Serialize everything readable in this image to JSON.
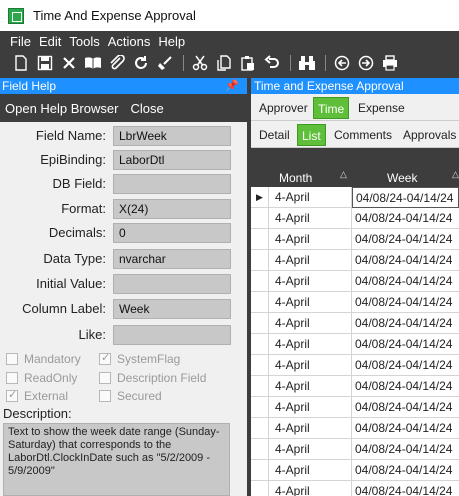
{
  "window": {
    "title": "Time And Expense Approval"
  },
  "menu": [
    "File",
    "Edit",
    "Tools",
    "Actions",
    "Help"
  ],
  "toolbar": {
    "icons": [
      "new-icon",
      "save-icon",
      "delete-icon",
      "open-book-icon",
      "attach-icon",
      "refresh-icon",
      "clear-icon",
      "cut-icon",
      "copy-icon",
      "paste-icon",
      "undo-icon",
      "binoculars-icon",
      "back-icon",
      "forward-icon",
      "print-icon"
    ]
  },
  "field_help": {
    "title": "Field Help",
    "open_help_browser": "Open Help Browser",
    "close": "Close",
    "fields": [
      {
        "label": "Field Name:",
        "value": "LbrWeek"
      },
      {
        "label": "EpiBinding:",
        "value": "LaborDtl"
      },
      {
        "label": "DB Field:",
        "value": ""
      },
      {
        "label": "Format:",
        "value": "X(24)"
      },
      {
        "label": "Decimals:",
        "value": "0"
      },
      {
        "label": "Data Type:",
        "value": "nvarchar"
      },
      {
        "label": "Initial Value:",
        "value": ""
      },
      {
        "label": "Column Label:",
        "value": "Week"
      },
      {
        "label": "Like:",
        "value": ""
      }
    ],
    "checkboxes": [
      {
        "label": "Mandatory",
        "checked": false
      },
      {
        "label": "SystemFlag",
        "checked": true
      },
      {
        "label": "ReadOnly",
        "checked": false
      },
      {
        "label": "Description Field",
        "checked": false
      },
      {
        "label": "External",
        "checked": true
      },
      {
        "label": "Secured",
        "checked": false
      }
    ],
    "description_label": "Description:",
    "description_text": "Text to show the week date range (Sunday-Saturday) that corresponds to the LaborDtl.ClockInDate such as \"5/2/2009 - 5/9/2009\""
  },
  "approval": {
    "title": "Time and Expense Approval",
    "tabs": [
      "Approver",
      "Time",
      "Expense"
    ],
    "active_tab": "Time",
    "subtabs": [
      "Detail",
      "List",
      "Comments",
      "Approvals"
    ],
    "active_subtab": "List",
    "columns": [
      "Month",
      "Week"
    ],
    "rows": [
      {
        "month": "4-April",
        "week": "04/08/24-04/14/24"
      },
      {
        "month": "4-April",
        "week": "04/08/24-04/14/24"
      },
      {
        "month": "4-April",
        "week": "04/08/24-04/14/24"
      },
      {
        "month": "4-April",
        "week": "04/08/24-04/14/24"
      },
      {
        "month": "4-April",
        "week": "04/08/24-04/14/24"
      },
      {
        "month": "4-April",
        "week": "04/08/24-04/14/24"
      },
      {
        "month": "4-April",
        "week": "04/08/24-04/14/24"
      },
      {
        "month": "4-April",
        "week": "04/08/24-04/14/24"
      },
      {
        "month": "4-April",
        "week": "04/08/24-04/14/24"
      },
      {
        "month": "4-April",
        "week": "04/08/24-04/14/24"
      },
      {
        "month": "4-April",
        "week": "04/08/24-04/14/24"
      },
      {
        "month": "4-April",
        "week": "04/08/24-04/14/24"
      },
      {
        "month": "4-April",
        "week": "04/08/24-04/14/24"
      },
      {
        "month": "4-April",
        "week": "04/08/24-04/14/24"
      },
      {
        "month": "4-April",
        "week": "04/08/24-04/14/24"
      }
    ]
  }
}
